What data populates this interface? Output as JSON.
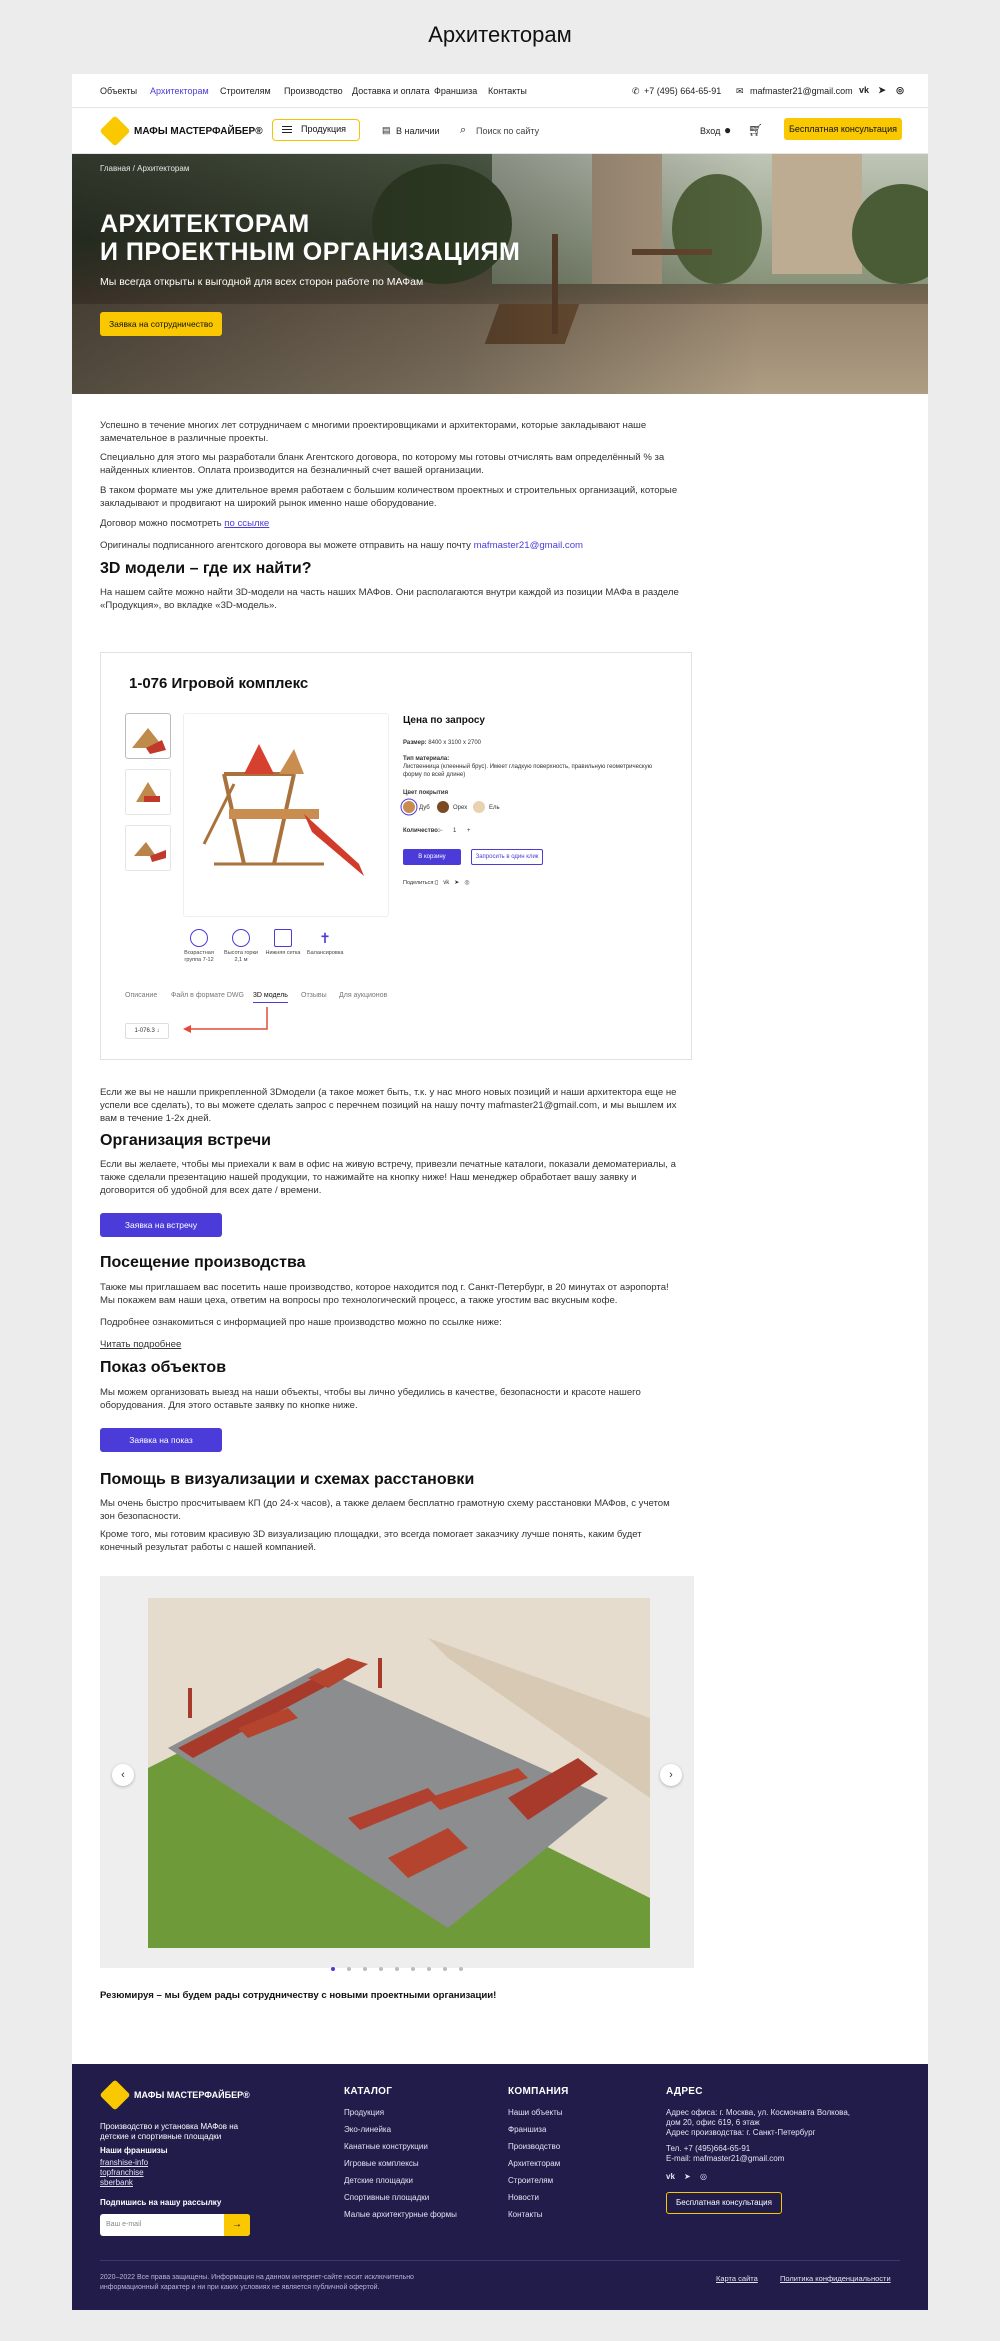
{
  "page_heading": "Архитекторам",
  "topnav": {
    "items": [
      "Объекты",
      "Архитекторам",
      "Строителям",
      "Производство",
      "Доставка и оплата",
      "Франшиза",
      "Контакты"
    ],
    "phone": "+7 (495) 664-65-91",
    "email": "mafmaster21@gmail.com",
    "social": [
      "vk-icon",
      "telegram-icon",
      "whatsapp-icon"
    ]
  },
  "header": {
    "logo": "МАФЫ МАСТЕРФАЙБЕР®",
    "products_button": "Продукция",
    "in_stock": "В наличии",
    "search_placeholder": "Поиск по сайту",
    "login": "Вход",
    "consult_button": "Бесплатная консультация"
  },
  "hero": {
    "breadcrumbs": "Главная  /  Архитекторам",
    "title_line1": "АРХИТЕКТОРАМ",
    "title_line2": "И ПРОЕКТНЫМ ОРГАНИЗАЦИЯМ",
    "subtitle": "Мы всегда открыты к выгодной для всех сторон работе по МАФам",
    "cta": "Заявка на сотрудничество"
  },
  "intro": {
    "p1": "Успешно в течение многих лет сотрудничаем с многими проектировщиками и архитекторами, которые закладывают наше замечательное в различные проекты.",
    "p2": "Специально для этого мы разработали бланк Агентского договора, по которому мы готовы отчислять вам определённый % за найденных клиентов. Оплата производится на безналичный счет вашей организации.",
    "p3": "В таком формате мы уже длительное время работаем с большим количеством проектных и строительных организаций, которые закладывают и продвигают на широкий рынок именно наше оборудование.",
    "p4_text": "Договор можно посмотреть ",
    "p4_link": "по ссылке",
    "p5_text": "Оригиналы подписанного агентского договора вы можете отправить на нашу почту ",
    "p5_link": "mafmaster21@gmail.com"
  },
  "models3d": {
    "heading": "3D модели – где их найти?",
    "text": "На нашем сайте можно найти 3D-модели на часть наших МАФов. Они располагаются внутри каждой из позиции МАФа в разделе «Продукция», во вкладке «3D-модель».",
    "card": {
      "title": "1-076 Игровой комплекс",
      "price": "Цена по запросу",
      "size_label": "Размер:",
      "size_value": "8400 х 3100 х 2700",
      "material_label": "Тип материала:",
      "material_value": "Лиственница (клеенный брус). Имеет гладкую поверхность, правильную геометрическую форму по всей длине)",
      "color_label": "Цвет покрытия",
      "colors": [
        "Дуб",
        "Орех",
        "Ель"
      ],
      "qty_label": "Количество:",
      "qty_value": "1",
      "cart_button": "В корзину",
      "request_button": "Запросить в один клик",
      "share_label": "Поделиться:",
      "features": [
        "Возрастная группа 7-12",
        "Высота горки 2,1 м",
        "Нижняя сетка",
        "Балансировка"
      ],
      "tabs": [
        "Описание",
        "Файл в формате DWG",
        "3D модель",
        "Отзывы",
        "Для аукционов"
      ],
      "file_label": "1-076.3 ↓"
    },
    "after": "Если же вы не нашли прикрепленной 3Dмодели (а такое может быть, т.к. у нас много новых позиций и наши архитектора еще не успели все сделать), то вы можете сделать запрос с перечнем позиций на нашу почту mafmaster21@gmail.com, и мы вышлем их вам в течение 1-2х дней."
  },
  "meeting": {
    "heading": "Организация встречи",
    "text": "Если вы желаете, чтобы мы приехали к вам в офис на живую встречу, привезли печатные каталоги, показали демоматериалы, а также сделали презентацию нашей продукции, то нажимайте на кнопку ниже! Наш менеджер обработает вашу заявку и договорится об удобной для всех дате / времени.",
    "button": "Заявка на встречу"
  },
  "visit": {
    "heading": "Посещение производства",
    "text": "Также мы приглашаем вас посетить наше производство, которое находится под г. Санкт-Петербург, в 20 минутах от аэропорта! Мы покажем вам наши цеха, ответим на вопросы про технологический процесс, а также угостим вас вкусным кофе.",
    "text2": "Подробнее ознакомиться с информацией про наше производство можно по ссылке ниже:",
    "link": "Читать подробнее"
  },
  "objects": {
    "heading": "Показ объектов",
    "text": "Мы можем организовать выезд на наши объекты, чтобы вы лично убедились в качестве, безопасности и красоте нашего оборудования. Для этого оставьте заявку по кнопке ниже.",
    "button": "Заявка на показ"
  },
  "viz": {
    "heading": "Помощь в визуализации и схемах расстановки",
    "text": "Мы очень быстро просчитываем КП (до 24-х часов), а также делаем бесплатно грамотную схему расстановки МАФов, с учетом зон безопасности.",
    "text2": "Кроме того, мы готовим красивую 3D визуализацию площадки, это всегда помогает заказчику лучше понять, каким будет конечный результат работы с нашей компанией.",
    "slides": 9,
    "active_slide": 1
  },
  "summary": "Резюмируя – мы будем рады сотрудничеству с новыми проектными организации!",
  "footer": {
    "logo": "МАФЫ МАСТЕРФАЙБЕР®",
    "tagline": "Производство и установка МАФов на детские и спортивные площадки",
    "franchise_heading": "Наши франшизы",
    "franchise_links": [
      "franshise-info",
      "topfranchise",
      "sberbank"
    ],
    "subscribe_label": "Подпишись на нашу рассылку",
    "email_placeholder": "Ваш e-mail",
    "catalog_heading": "КАТАЛОГ",
    "catalog": [
      "Продукция",
      "Эко-линейка",
      "Канатные конструкции",
      "Игровые комплексы",
      "Детские площадки",
      "Спортивные площадки",
      "Малые архитектурные формы"
    ],
    "company_heading": "КОМПАНИЯ",
    "company": [
      "Наши объекты",
      "Франшиза",
      "Производство",
      "Архитекторам",
      "Строителям",
      "Новости",
      "Контакты"
    ],
    "address_heading": "АДРЕС",
    "address1": "Адрес офиса: г. Москва, ул. Космонавта Волкова,",
    "address2": "дом 20, офис 619, 6 этаж",
    "address3": "Адрес производства: г. Санкт-Петербург",
    "phone": "Тел. +7 (495)664-65-91",
    "email": "E-mail: mafmaster21@gmail.com",
    "consult_button": "Бесплатная консультация",
    "copyright1": "2020–2022 Все права защищены. Информация на данном интернет-сайте носит исключительно",
    "copyright2": "информационный характер и ни при каких условиях не является публичной офертой.",
    "sitemap": "Карта сайта",
    "privacy": "Политика конфиденциальности"
  },
  "colors": {
    "accent": "#4b3bd9",
    "brand_yellow": "#f9c800",
    "footer_bg": "#221c4a"
  }
}
